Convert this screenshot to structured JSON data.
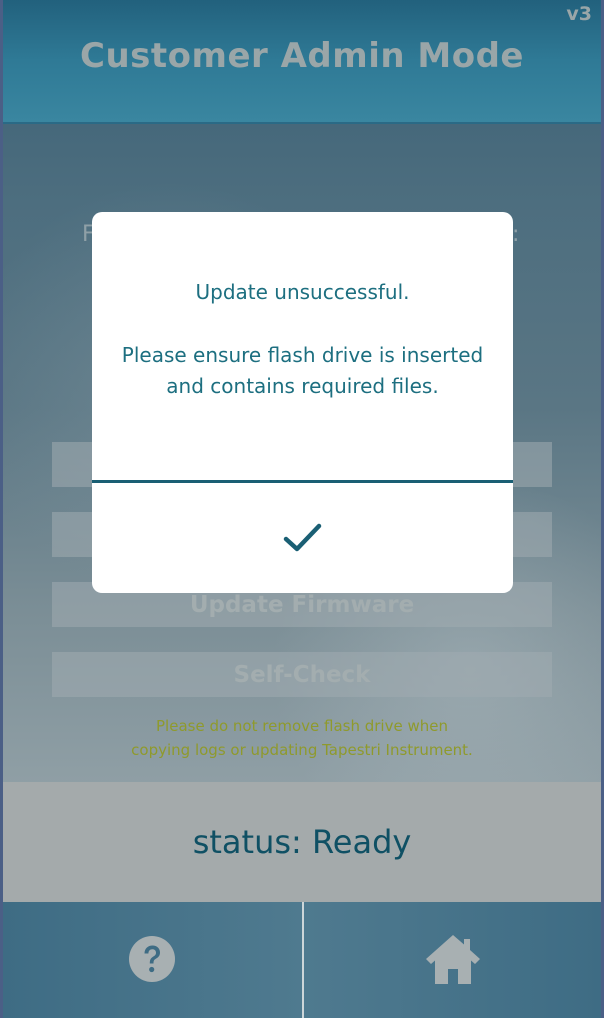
{
  "app": {
    "title": "Customer Admin Mode",
    "version": "v3"
  },
  "background": {
    "partial_text_left": "F",
    "partial_text_right": ":"
  },
  "menu": {
    "update_firmware_label": "Update Firmware",
    "self_check_label": "Self-Check"
  },
  "warning": {
    "line1": "Please do not remove flash drive when",
    "line2": "copying logs or updating Tapestri Instrument."
  },
  "status": {
    "text": "status: Ready"
  },
  "bottom_nav": {
    "help_icon": "question-circle-icon",
    "home_icon": "home-icon"
  },
  "dialog": {
    "title": "Update unsuccessful.",
    "message_line1": "Please ensure flash drive is inserted",
    "message_line2": "and contains required files.",
    "confirm_icon": "checkmark-icon"
  },
  "colors": {
    "header_bg": "#2f7a96",
    "dialog_text": "#1d6f80",
    "status_text": "#0f5064",
    "status_bg": "#a4aaab",
    "warning_text": "#8f9a2c"
  }
}
